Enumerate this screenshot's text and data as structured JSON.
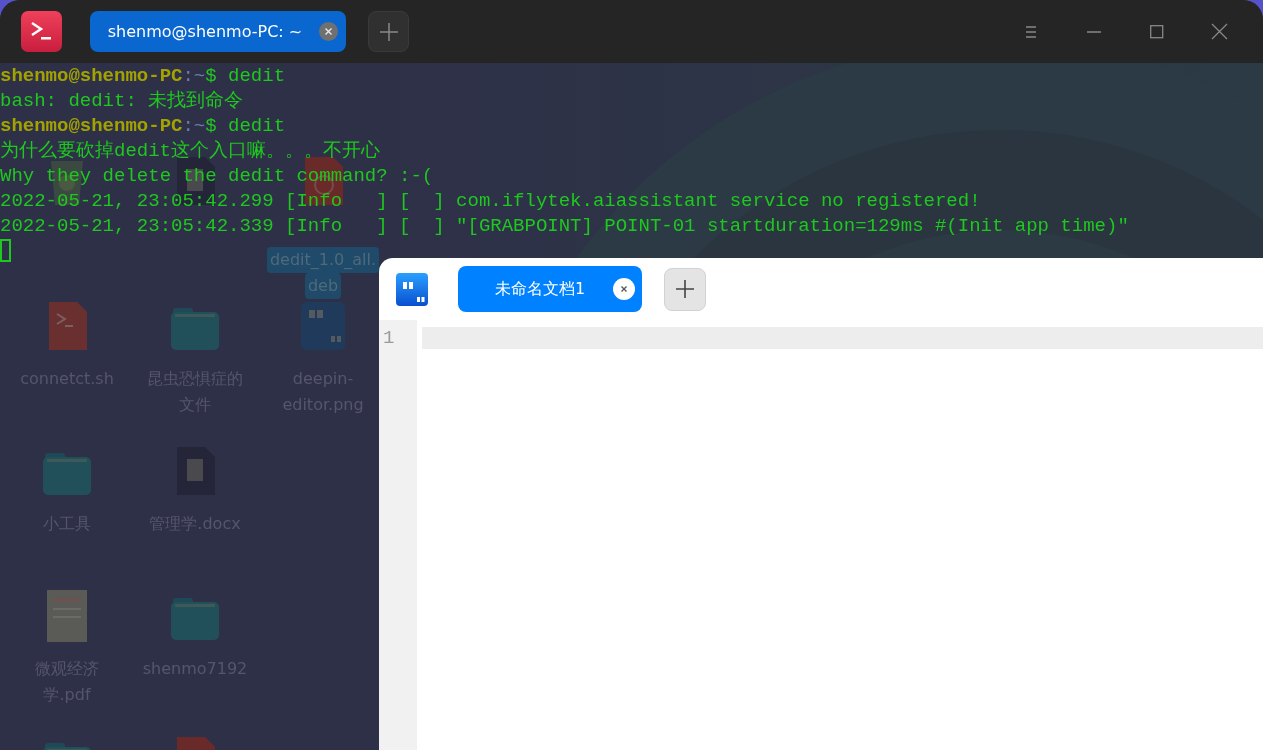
{
  "desktop": {
    "icons": [
      {
        "kind": "trash"
      },
      {
        "kind": "script",
        "lines": [
          "connetct.sh"
        ],
        "selected": false
      },
      {
        "kind": "folder",
        "lines": [
          "小工具"
        ],
        "selected": false
      },
      {
        "kind": "pdf",
        "lines": [
          "微观经济",
          "学.pdf"
        ],
        "selected": false
      },
      {
        "kind": "folder"
      },
      {
        "kind": "office"
      },
      {
        "kind": "folder",
        "lines": [
          "昆虫恐惧症的",
          "文件"
        ],
        "selected": false
      },
      {
        "kind": "office",
        "lines": [
          "管理学.docx"
        ],
        "selected": false
      },
      {
        "kind": "folder",
        "lines": [
          "shenmo7192"
        ],
        "selected": false
      },
      {
        "kind": "package"
      },
      {
        "kind": "package",
        "lines": [
          "dedit_1.0_all.",
          "deb"
        ],
        "selected": true
      },
      {
        "lines": [
          "deepin-",
          "editor.png"
        ],
        "selected": false
      }
    ]
  },
  "terminal": {
    "tabs": [
      {
        "label": "shenmo@shenmo-PC: ~",
        "selected": true
      }
    ],
    "lines": [
      {
        "segments": [
          {
            "kind": "user",
            "text": "shenmo@shenmo-PC"
          },
          {
            "kind": "path",
            "text": ":~"
          },
          {
            "kind": "output",
            "text": "$ dedit"
          }
        ]
      },
      {
        "segments": [
          {
            "kind": "output",
            "text": "bash: dedit: 未找到命令"
          }
        ]
      },
      {
        "segments": [
          {
            "kind": "user",
            "text": "shenmo@shenmo-PC"
          },
          {
            "kind": "path",
            "text": ":~"
          },
          {
            "kind": "output",
            "text": "$ dedit"
          }
        ]
      },
      {
        "segments": [
          {
            "kind": "output",
            "text": "为什么要砍掉dedit这个入口嘛。。。不开心"
          }
        ]
      },
      {
        "segments": [
          {
            "kind": "output",
            "text": "Why they delete the dedit command? :-("
          }
        ]
      },
      {
        "segments": [
          {
            "kind": "output",
            "text": "2022-05-21, 23:05:42.299 [Info   ] [  ] com.iflytek.aiassistant service no registered!"
          }
        ]
      },
      {
        "segments": [
          {
            "kind": "output",
            "text": "2022-05-21, 23:05:42.339 [Info   ] [  ] \"[GRABPOINT] POINT-01 startduration=129ms #(Init app time)\""
          }
        ]
      }
    ],
    "cursor_visible": true
  },
  "editor": {
    "tabs": [
      {
        "label": "未命名文档1",
        "selected": true
      }
    ],
    "line_numbers": [
      "1"
    ]
  }
}
